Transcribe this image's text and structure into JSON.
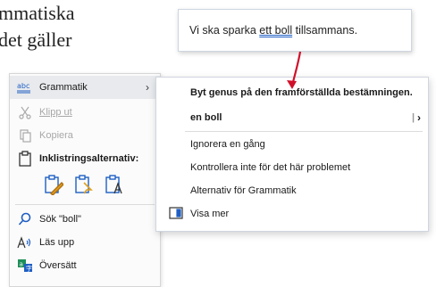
{
  "background": {
    "line1": "mmatiska",
    "line2": "det gäller"
  },
  "callout": {
    "before": "Vi ska sparka ",
    "error": "ett boll",
    "after": " tillsammans."
  },
  "menu": {
    "items": [
      {
        "label": "Grammatik",
        "icon": "grammar-abc-icon"
      },
      {
        "label": "Klipp ut",
        "icon": "scissors-icon"
      },
      {
        "label": "Kopiera",
        "icon": "copy-icon"
      },
      {
        "label": "Inklistringsalternativ:",
        "icon": "paste-icon"
      },
      {
        "label": "Sök \"boll\"",
        "icon": "search-icon"
      },
      {
        "label": "Läs upp",
        "icon": "read-aloud-icon"
      },
      {
        "label": "Översätt",
        "icon": "translate-icon"
      }
    ]
  },
  "submenu": {
    "items": [
      {
        "label": "Byt genus på den framförställda bestämningen."
      },
      {
        "label": "en boll"
      },
      {
        "label": "Ignorera en gång"
      },
      {
        "label": "Kontrollera inte för det här problemet"
      },
      {
        "label": "Alternativ för Grammatik"
      },
      {
        "label": "Visa mer",
        "icon": "show-more-icon"
      }
    ]
  },
  "colors": {
    "accent": "#1f5fc4",
    "arrow": "#d0102a"
  }
}
